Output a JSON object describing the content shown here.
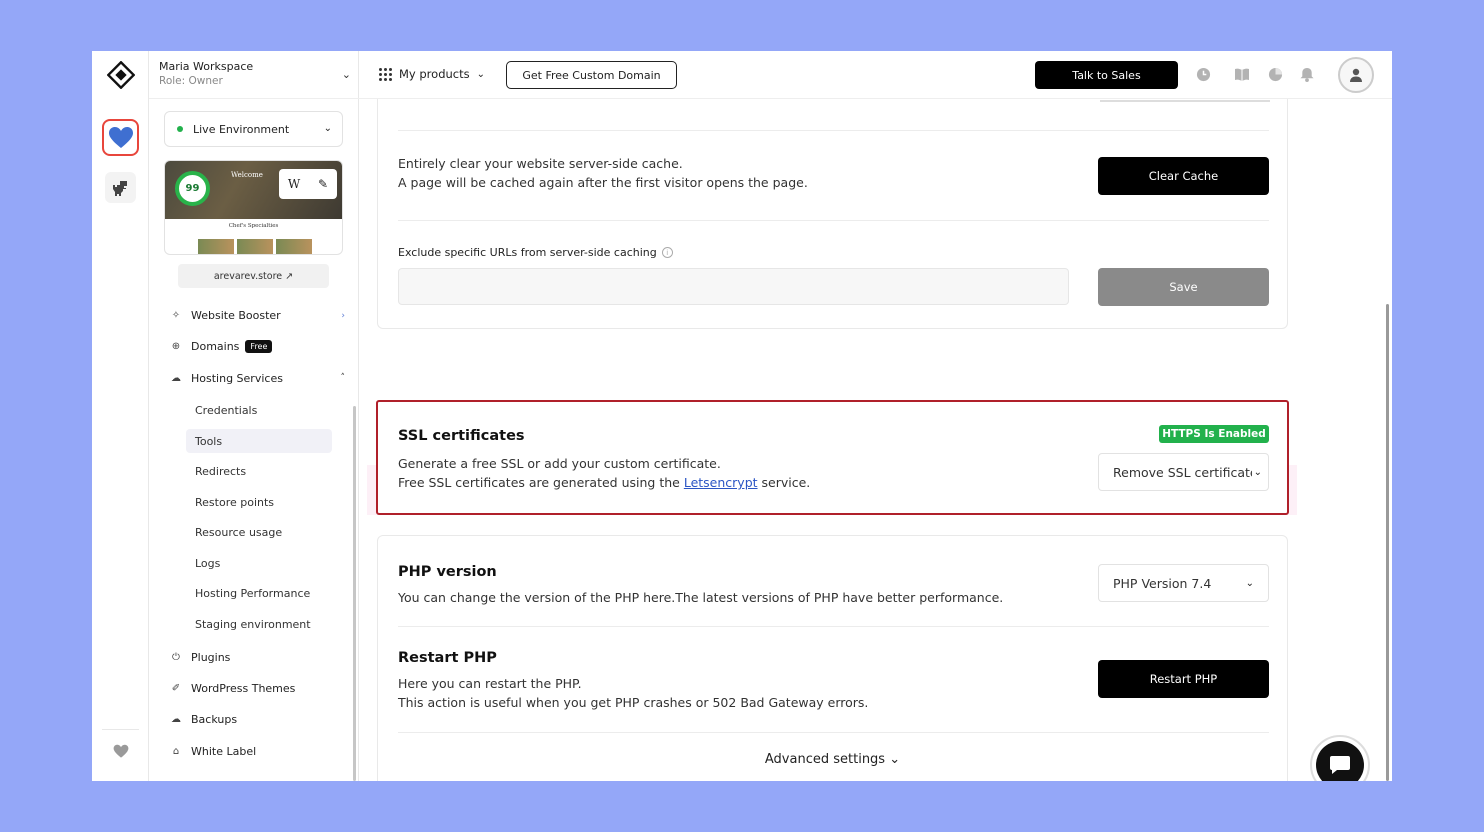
{
  "workspace": {
    "name": "Maria Workspace",
    "role": "Role: Owner"
  },
  "environment": {
    "label": "Live Environment"
  },
  "site_preview": {
    "score": "99",
    "hero_title": "Welcome",
    "subtitle": "Chef's Specialties",
    "tool_letter": "W"
  },
  "site_url": "arevarev.store ↗",
  "nav": {
    "website_booster": "Website Booster",
    "domains": "Domains",
    "domains_badge": "Free",
    "hosting_services": "Hosting Services",
    "sub_items": [
      "Credentials",
      "Tools",
      "Redirects",
      "Restore points",
      "Resource usage",
      "Logs",
      "Hosting Performance",
      "Staging environment"
    ],
    "plugins": "Plugins",
    "wordpress_themes": "WordPress Themes",
    "backups": "Backups",
    "white_label": "White Label"
  },
  "topbar": {
    "my_products": "My products",
    "free_domain": "Get Free Custom Domain",
    "talk_to_sales": "Talk to Sales"
  },
  "cache": {
    "line1": "Entirely clear your website server-side cache.",
    "line2": "A page will be cached again after the first visitor opens the page.",
    "clear_button": "Clear Cache",
    "exclude_label": "Exclude specific URLs from server-side caching",
    "info_icon": "i",
    "save_button": "Save"
  },
  "ssl": {
    "title": "SSL certificates",
    "badge": "HTTPS Is Enabled",
    "line1": "Generate a free SSL or add your custom certificate.",
    "line2_pre": "Free SSL certificates are generated using the ",
    "link": "Letsencrypt",
    "line2_post": " service.",
    "select_value": "Remove SSL certificate"
  },
  "php": {
    "title": "PHP version",
    "desc": "You can change the version of the PHP here.The latest versions of PHP have better performance.",
    "select_value": "PHP Version 7.4",
    "restart_title": "Restart PHP",
    "restart_line1": "Here you can restart the PHP.",
    "restart_line2": "This action is useful when you get PHP crashes or 502 Bad Gateway errors.",
    "restart_button": "Restart PHP",
    "advanced": "Advanced settings ⌄"
  },
  "colors": {
    "accent_green": "#22b14c",
    "ssl_border": "#b0202a",
    "link": "#2b55c4",
    "page_bg": "#94a7f8"
  }
}
